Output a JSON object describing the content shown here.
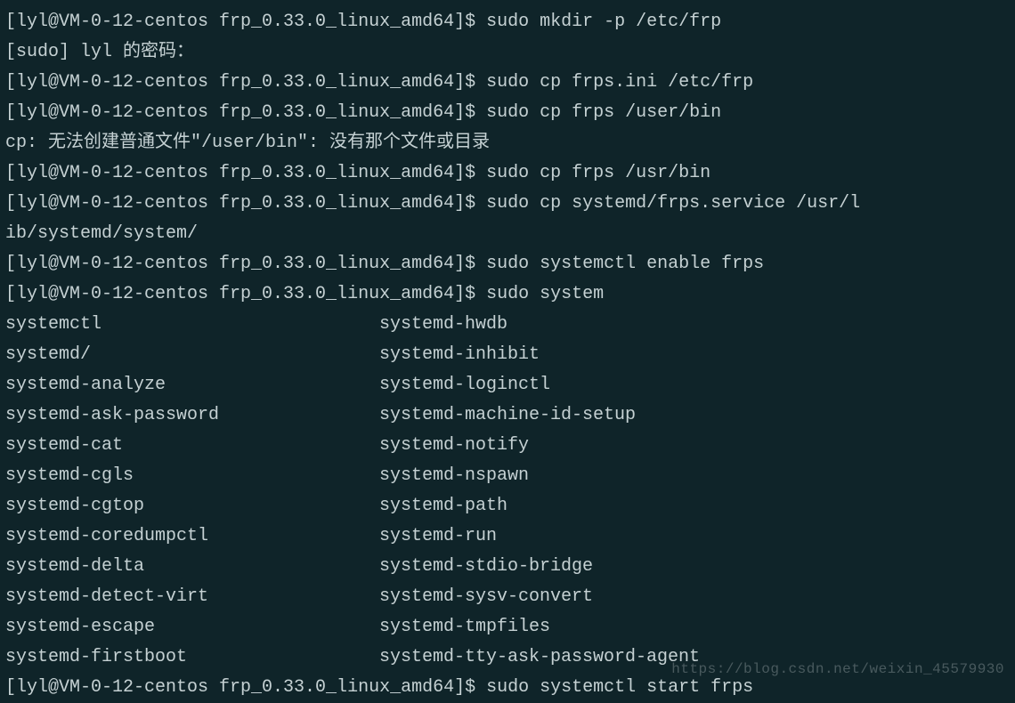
{
  "terminal": {
    "prompt_user": "lyl",
    "prompt_host": "VM-0-12-centos",
    "prompt_dir": "frp_0.33.0_linux_amd64",
    "lines": [
      {
        "prompt": "[lyl@VM-0-12-centos frp_0.33.0_linux_amd64]$ ",
        "cmd": "sudo mkdir -p /etc/frp"
      },
      {
        "text": "[sudo] lyl 的密码："
      },
      {
        "prompt": "[lyl@VM-0-12-centos frp_0.33.0_linux_amd64]$ ",
        "cmd": "sudo cp frps.ini /etc/frp"
      },
      {
        "prompt": "[lyl@VM-0-12-centos frp_0.33.0_linux_amd64]$ ",
        "cmd": "sudo cp frps /user/bin"
      },
      {
        "text": "cp: 无法创建普通文件\"/user/bin\": 没有那个文件或目录"
      },
      {
        "prompt": "[lyl@VM-0-12-centos frp_0.33.0_linux_amd64]$ ",
        "cmd": "sudo cp frps /usr/bin"
      },
      {
        "prompt": "[lyl@VM-0-12-centos frp_0.33.0_linux_amd64]$ ",
        "cmd": "sudo cp systemd/frps.service /usr/l"
      },
      {
        "text": "ib/systemd/system/"
      },
      {
        "prompt": "[lyl@VM-0-12-centos frp_0.33.0_linux_amd64]$ ",
        "cmd": "sudo systemctl enable frps"
      },
      {
        "prompt": "[lyl@VM-0-12-centos frp_0.33.0_linux_amd64]$ ",
        "cmd": "sudo system"
      }
    ],
    "completions": [
      {
        "a": "systemctl",
        "b": "systemd-hwdb"
      },
      {
        "a": "systemd/",
        "b": "systemd-inhibit"
      },
      {
        "a": "systemd-analyze",
        "b": "systemd-loginctl"
      },
      {
        "a": "systemd-ask-password",
        "b": "systemd-machine-id-setup"
      },
      {
        "a": "systemd-cat",
        "b": "systemd-notify"
      },
      {
        "a": "systemd-cgls",
        "b": "systemd-nspawn"
      },
      {
        "a": "systemd-cgtop",
        "b": "systemd-path"
      },
      {
        "a": "systemd-coredumpctl",
        "b": "systemd-run"
      },
      {
        "a": "systemd-delta",
        "b": "systemd-stdio-bridge"
      },
      {
        "a": "systemd-detect-virt",
        "b": "systemd-sysv-convert"
      },
      {
        "a": "systemd-escape",
        "b": "systemd-tmpfiles"
      },
      {
        "a": "systemd-firstboot",
        "b": "systemd-tty-ask-password-agent"
      }
    ],
    "final_line": {
      "prompt": "[lyl@VM-0-12-centos frp_0.33.0_linux_amd64]$ ",
      "cmd": "sudo systemctl start frps"
    },
    "watermark": "https://blog.csdn.net/weixin_45579930"
  }
}
